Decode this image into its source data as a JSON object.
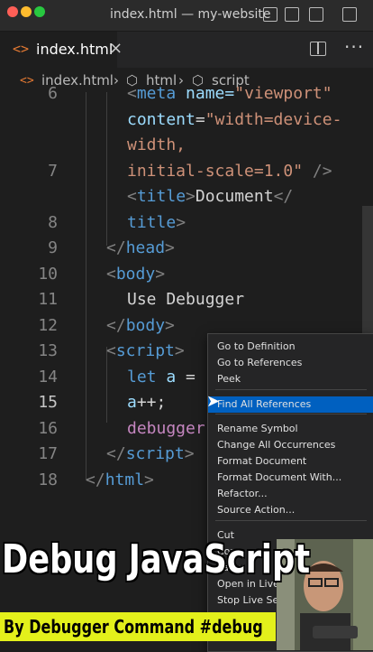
{
  "window": {
    "title": "index.html — my-website"
  },
  "tab": {
    "label": "index.html",
    "file_icon": "<>"
  },
  "breadcrumb": {
    "file": "index.html",
    "sep": "›",
    "html": "html",
    "script": "script"
  },
  "editor": {
    "line_numbers": [
      "6",
      "",
      "",
      "7",
      "",
      "8",
      "9",
      "10",
      "11",
      "12",
      "13",
      "14",
      "15",
      "16",
      "17",
      "18"
    ],
    "lines": [
      [
        {
          "t": "<",
          "c": "t-br"
        },
        {
          "t": "meta",
          "c": "t-tag"
        },
        {
          "t": " name=",
          "c": "t-attr"
        },
        {
          "t": "\"viewport\"",
          "c": "t-str"
        }
      ],
      [
        {
          "t": "content",
          "c": "t-attr"
        },
        {
          "t": "=",
          "c": "t-txt"
        },
        {
          "t": "\"width=device-",
          "c": "t-str"
        }
      ],
      [
        {
          "t": "width,",
          "c": "t-str"
        }
      ],
      [
        {
          "t": "initial-scale=1.0\"",
          "c": "t-str"
        },
        {
          "t": " />",
          "c": "t-br"
        }
      ],
      [
        {
          "t": "<",
          "c": "t-br"
        },
        {
          "t": "title",
          "c": "t-tag"
        },
        {
          "t": ">",
          "c": "t-br"
        },
        {
          "t": "Document",
          "c": "t-txt"
        },
        {
          "t": "</",
          "c": "t-br"
        }
      ],
      [
        {
          "t": "title",
          "c": "t-tag"
        },
        {
          "t": ">",
          "c": "t-br"
        }
      ],
      [
        {
          "t": "</",
          "c": "t-br"
        },
        {
          "t": "head",
          "c": "t-tag"
        },
        {
          "t": ">",
          "c": "t-br"
        }
      ],
      [
        {
          "t": "<",
          "c": "t-br"
        },
        {
          "t": "body",
          "c": "t-tag"
        },
        {
          "t": ">",
          "c": "t-br"
        }
      ],
      [
        {
          "t": "Use Debugger",
          "c": "t-txt"
        }
      ],
      [
        {
          "t": "</",
          "c": "t-br"
        },
        {
          "t": "body",
          "c": "t-tag"
        },
        {
          "t": ">",
          "c": "t-br"
        }
      ],
      [
        {
          "t": "<",
          "c": "t-br"
        },
        {
          "t": "script",
          "c": "t-tag"
        },
        {
          "t": ">",
          "c": "t-br"
        }
      ],
      [
        {
          "t": "let",
          "c": "t-kw"
        },
        {
          "t": " a",
          "c": "t-var"
        },
        {
          "t": " =",
          "c": "t-txt"
        }
      ],
      [
        {
          "t": "a",
          "c": "t-var"
        },
        {
          "t": "++;",
          "c": "t-txt"
        }
      ],
      [
        {
          "t": "debugger",
          "c": "t-ctl"
        }
      ],
      [
        {
          "t": "</",
          "c": "t-br"
        },
        {
          "t": "script",
          "c": "t-tag"
        },
        {
          "t": ">",
          "c": "t-br"
        }
      ],
      [
        {
          "t": "</",
          "c": "t-br"
        },
        {
          "t": "html",
          "c": "t-tag"
        },
        {
          "t": ">",
          "c": "t-br"
        }
      ],
      []
    ]
  },
  "context_menu": {
    "items": [
      "Go to Definition",
      "Go to References",
      "Peek",
      "Find All References",
      "Rename Symbol",
      "Change All Occurrences",
      "Format Document",
      "Format Document With...",
      "Refactor...",
      "Source Action...",
      "Cut",
      "Copy",
      "Paste",
      "Open in Live...",
      "Stop Live Ser..."
    ],
    "selected": "Find All References"
  },
  "overlay": {
    "title": "Debug JavaScript",
    "banner": "By Debugger Command #debug"
  },
  "colors": {
    "selection": "#0060c0",
    "banner": "#e3f01b"
  }
}
